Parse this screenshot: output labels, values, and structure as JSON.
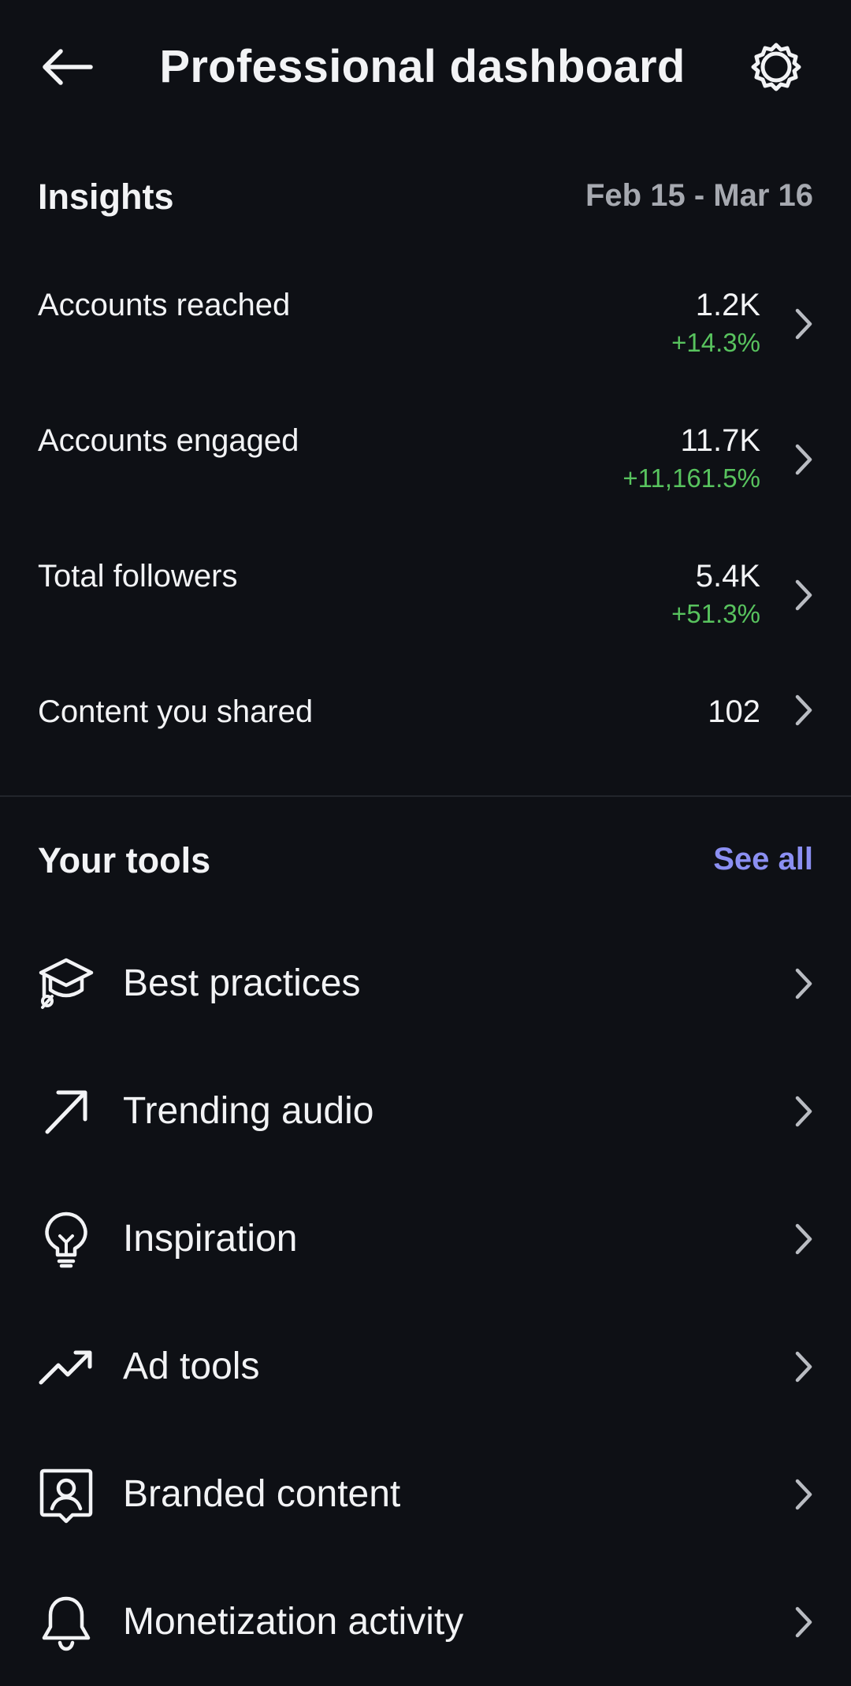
{
  "header": {
    "title": "Professional dashboard",
    "back_icon": "arrow-left-icon",
    "settings_icon": "gear-icon"
  },
  "insights": {
    "title": "Insights",
    "date_range": "Feb 15 - Mar 16",
    "rows": [
      {
        "label": "Accounts reached",
        "value": "1.2K",
        "change": "+14.3%"
      },
      {
        "label": "Accounts engaged",
        "value": "11.7K",
        "change": "+11,161.5%"
      },
      {
        "label": "Total followers",
        "value": "5.4K",
        "change": "+51.3%"
      },
      {
        "label": "Content you shared",
        "value": "102",
        "change": ""
      }
    ]
  },
  "tools": {
    "title": "Your tools",
    "see_all": "See all",
    "items": [
      {
        "label": "Best practices",
        "icon": "graduation-cap-icon"
      },
      {
        "label": "Trending audio",
        "icon": "arrow-up-right-icon"
      },
      {
        "label": "Inspiration",
        "icon": "lightbulb-icon"
      },
      {
        "label": "Ad tools",
        "icon": "trending-up-icon"
      },
      {
        "label": "Branded content",
        "icon": "person-badge-icon"
      },
      {
        "label": "Monetization activity",
        "icon": "bell-icon"
      }
    ]
  },
  "colors": {
    "background": "#0e1015",
    "text": "#f2f3f5",
    "secondary_text": "#a6a9b0",
    "positive_change": "#58c35e",
    "link": "#8b8ff2"
  }
}
